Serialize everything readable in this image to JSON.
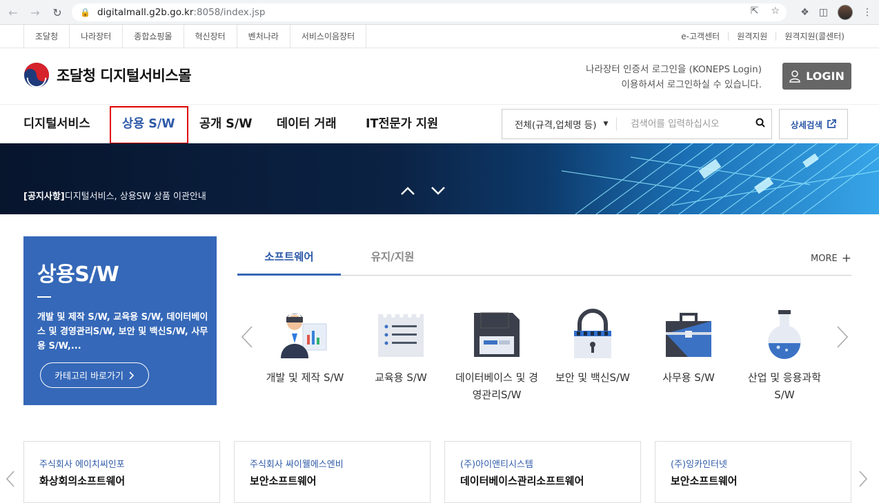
{
  "browser": {
    "url_host": "digitalmall.g2b.go.kr",
    "url_path": ":8058/index.jsp"
  },
  "util": {
    "left": [
      "조달청",
      "나라장터",
      "종합쇼핑몰",
      "혁신장터",
      "벤처나라",
      "서비스이음장터"
    ],
    "right": [
      "e-고객센터",
      "원격지원",
      "원격지원(콜센터)"
    ]
  },
  "header": {
    "site_title": "조달청 디지털서비스몰",
    "login_note_1": "나라장터 인증서 로그인을 (KONEPS Login)",
    "login_note_2": "이용하셔서 로그인하실 수 있습니다.",
    "login_label": "LOGIN"
  },
  "gnb": {
    "items": [
      "디지털서비스",
      "상용 S/W",
      "공개 S/W",
      "데이터 거래",
      "IT전문가 지원"
    ],
    "search_category": "전체(규격,업체명 등)",
    "search_placeholder": "검색어를 입력하십시오",
    "detail_search": "상세검색"
  },
  "banner": {
    "notice_tag": "[공지사항]",
    "notice_text": "디지털서비스, 상용SW 상품 이관안내"
  },
  "category_panel": {
    "title": "상용S/W",
    "description": "개발 및 제작 S/W, 교육용 S/W, 데이터베이스 및 경영관리S/W, 보안 및 백신S/W, 사무용 S/W,...",
    "button": "카테고리 바로가기"
  },
  "tabs": {
    "items": [
      "소프트웨어",
      "유지/지원"
    ],
    "more": "MORE"
  },
  "categories": [
    {
      "label": "개발 및 제작 S/W",
      "icon": "developer-icon"
    },
    {
      "label": "교육용 S/W",
      "icon": "notepad-icon"
    },
    {
      "label": "데이터베이스 및 경영관리S/W",
      "icon": "floppy-disk-icon"
    },
    {
      "label": "보안 및 백신S/W",
      "icon": "padlock-icon"
    },
    {
      "label": "사무용 S/W",
      "icon": "briefcase-icon"
    },
    {
      "label": "산업 및 응용과학 S/W",
      "icon": "flask-icon"
    }
  ],
  "cards": [
    {
      "company": "주식회사 에이치씨인포",
      "product": "화상회의소프트웨어"
    },
    {
      "company": "주식회사 싸이웰에스엔비",
      "product": "보안소프트웨어"
    },
    {
      "company": "(주)아이앤티시스템",
      "product": "데이터베이스관리소프트웨어"
    },
    {
      "company": "(주)잉카인터넷",
      "product": "보안소프트웨어"
    }
  ],
  "colors": {
    "accent": "#3568b8",
    "active_text": "#2e5aa8",
    "login_bg": "#666666"
  }
}
